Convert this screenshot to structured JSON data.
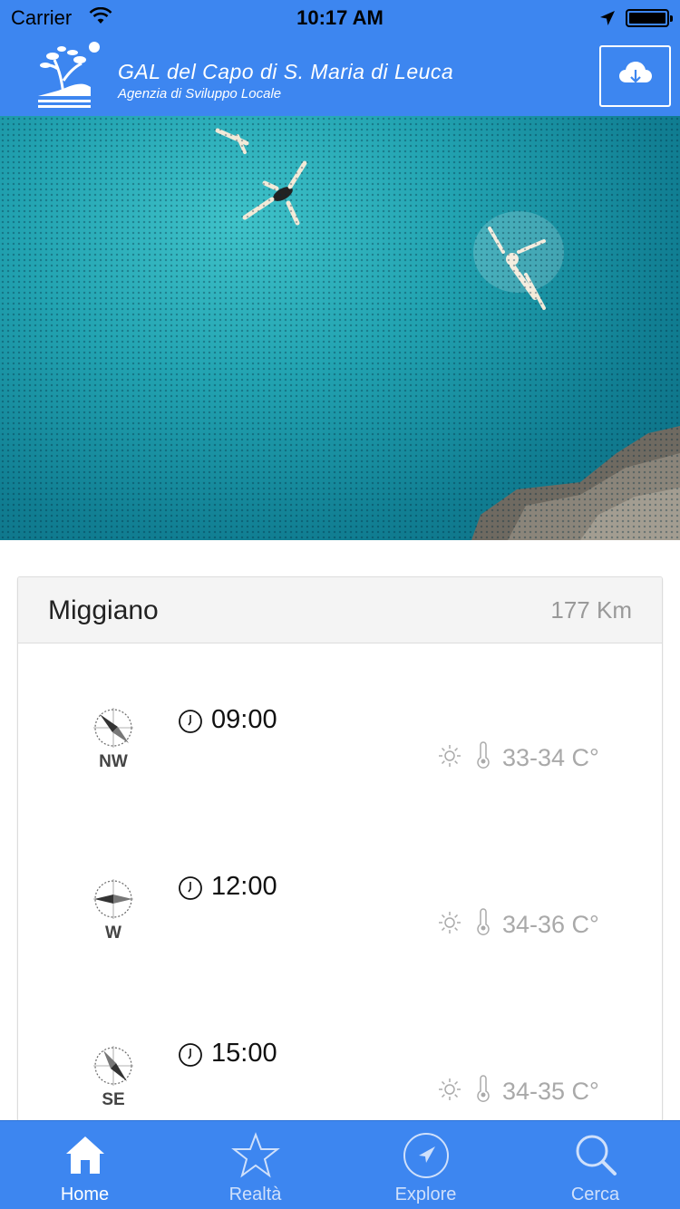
{
  "status_bar": {
    "carrier": "Carrier",
    "time": "10:17 AM",
    "icons": [
      "wifi-icon",
      "location-arrow-icon",
      "battery-icon"
    ]
  },
  "header": {
    "logo_line1": "GAL del Capo di S. Maria di Leuca",
    "logo_line2": "Agenzia di Sviluppo Locale",
    "download_icon": "cloud-download-icon"
  },
  "card": {
    "title": "Miggiano",
    "distance": "177 Km",
    "forecasts": [
      {
        "wind": "NW",
        "time": "09:00",
        "temperature": "33-34 C°"
      },
      {
        "wind": "W",
        "time": "12:00",
        "temperature": "34-36 C°"
      },
      {
        "wind": "SE",
        "time": "15:00",
        "temperature": "34-35 C°"
      }
    ]
  },
  "tab_bar": {
    "tabs": [
      {
        "label": "Home",
        "icon": "home-icon",
        "active": true
      },
      {
        "label": "Realtà",
        "icon": "star-icon",
        "active": false
      },
      {
        "label": "Explore",
        "icon": "compass-navigation-icon",
        "active": false
      },
      {
        "label": "Cerca",
        "icon": "search-icon",
        "active": false
      }
    ]
  },
  "colors": {
    "brand_blue": "#3d86f0",
    "muted_text": "#a9a9a9"
  }
}
